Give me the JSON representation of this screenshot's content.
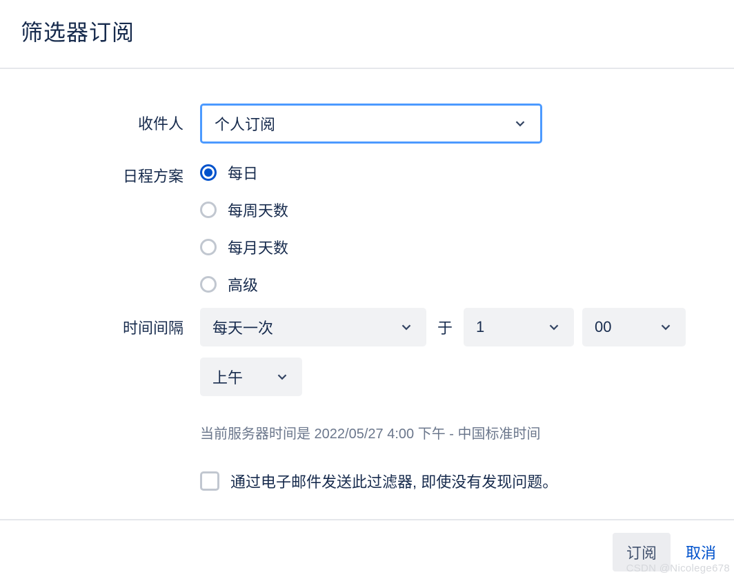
{
  "header": {
    "title": "筛选器订阅"
  },
  "form": {
    "recipient": {
      "label": "收件人",
      "value": "个人订阅"
    },
    "schedule": {
      "label": "日程方案",
      "options": [
        {
          "label": "每日",
          "checked": true
        },
        {
          "label": "每周天数",
          "checked": false
        },
        {
          "label": "每月天数",
          "checked": false
        },
        {
          "label": "高级",
          "checked": false
        }
      ]
    },
    "interval": {
      "label": "时间间隔",
      "frequency": "每天一次",
      "at_word": "于",
      "hour": "1",
      "minute": "00",
      "ampm": "上午"
    },
    "server_time": "当前服务器时间是 2022/05/27 4:00 下午 - 中国标准时间",
    "email_checkbox": {
      "label": "通过电子邮件发送此过滤器, 即使没有发现问题。",
      "checked": false
    }
  },
  "footer": {
    "submit": "订阅",
    "cancel": "取消"
  },
  "watermark": "CSDN @Nicolege678"
}
